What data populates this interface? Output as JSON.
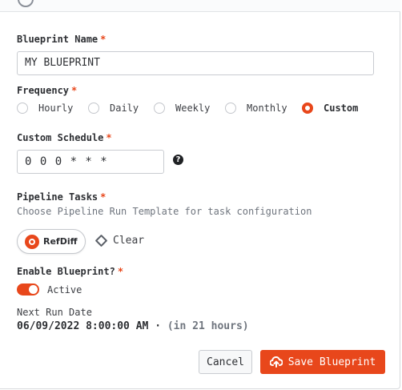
{
  "colors": {
    "accent": "#e8471b",
    "text": "#2d2f33",
    "muted": "#6f757e"
  },
  "form": {
    "blueprint_name": {
      "label": "Blueprint Name",
      "required": "*",
      "value": "MY BLUEPRINT"
    },
    "frequency": {
      "label": "Frequency",
      "required": "*",
      "options": [
        "Hourly",
        "Daily",
        "Weekly",
        "Monthly",
        "Custom"
      ],
      "selected": "Custom"
    },
    "custom_schedule": {
      "label": "Custom Schedule",
      "required": "*",
      "value": "0 0 0 * * *",
      "help_icon": "question-icon",
      "help_glyph": "?"
    },
    "pipeline_tasks": {
      "label": "Pipeline Tasks",
      "required": "*",
      "hint": "Choose Pipeline Run Template for task configuration",
      "task": {
        "label": "RefDiff",
        "icon": "refdiff-icon"
      },
      "clear_label": "Clear",
      "clear_icon": "eraser-icon"
    },
    "enable": {
      "label": "Enable Blueprint?",
      "required": "*",
      "toggle_state": "on",
      "toggle_label": "Active"
    },
    "next_run": {
      "label": "Next Run Date",
      "date": "06/09/2022 8:00:00 AM",
      "separator": " · ",
      "relative": "(in 21 hours)"
    }
  },
  "actions": {
    "cancel_label": "Cancel",
    "save_label": "Save Blueprint",
    "save_icon": "cloud-upload-icon"
  }
}
